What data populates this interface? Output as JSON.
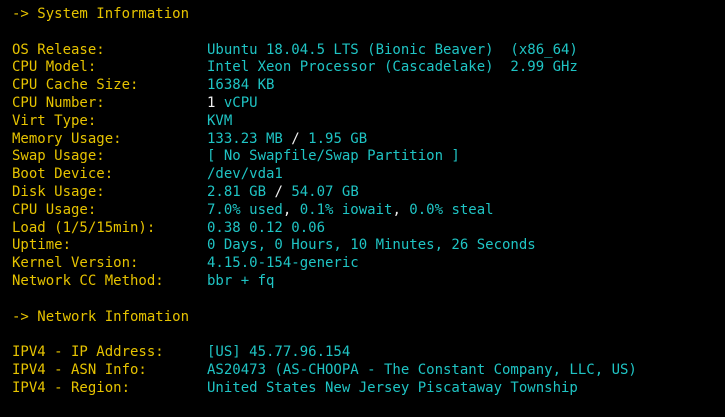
{
  "sections": {
    "system": {
      "heading": "-> System Information"
    },
    "network": {
      "heading": "-> Network Infomation"
    }
  },
  "system_rows": [
    {
      "label": "OS Release:",
      "value": "Ubuntu 18.04.5 LTS (Bionic Beaver)  (x86_64)"
    },
    {
      "label": "CPU Model:",
      "value": "Intel Xeon Processor (Cascadelake)  2.99 GHz"
    },
    {
      "label": "CPU Cache Size:",
      "value": "16384 KB"
    },
    {
      "label": "CPU Number:",
      "value_a": "1",
      "value_b": " vCPU"
    },
    {
      "label": "Virt Type:",
      "value": "KVM"
    },
    {
      "label": "Memory Usage:",
      "value_a": "133.23 MB",
      "sep": " / ",
      "value_b": "1.95 GB"
    },
    {
      "label": "Swap Usage:",
      "value": "[ No Swapfile/Swap Partition ]"
    },
    {
      "label": "Boot Device:",
      "value": "/dev/vda1"
    },
    {
      "label": "Disk Usage:",
      "value_a": "2.81 GB",
      "sep": " / ",
      "value_b": "54.07 GB"
    },
    {
      "label": "CPU Usage:",
      "value_a": "7.0% used",
      "sep1": ", ",
      "value_b": "0.1% iowait",
      "sep2": ", ",
      "value_c": "0.0% steal"
    },
    {
      "label": "Load (1/5/15min):",
      "value": "0.38 0.12 0.06"
    },
    {
      "label": "Uptime:",
      "value": "0 Days, 0 Hours, 10 Minutes, 26 Seconds"
    },
    {
      "label": "Kernel Version:",
      "value": "4.15.0-154-generic"
    },
    {
      "label": "Network CC Method:",
      "value": "bbr + fq"
    }
  ],
  "network_rows": [
    {
      "label": "IPV4 - IP Address:",
      "value": "[US] 45.77.96.154"
    },
    {
      "label": "IPV4 - ASN Info:",
      "value": "AS20473 (AS-CHOOPA - The Constant Company, LLC, US)"
    },
    {
      "label": "IPV4 - Region:",
      "value": "United States New Jersey Piscataway Township"
    }
  ],
  "colors": {
    "background": "#000000",
    "label": "#e6c300",
    "value": "#1fc4c4",
    "separator": "#f0f0f0"
  }
}
